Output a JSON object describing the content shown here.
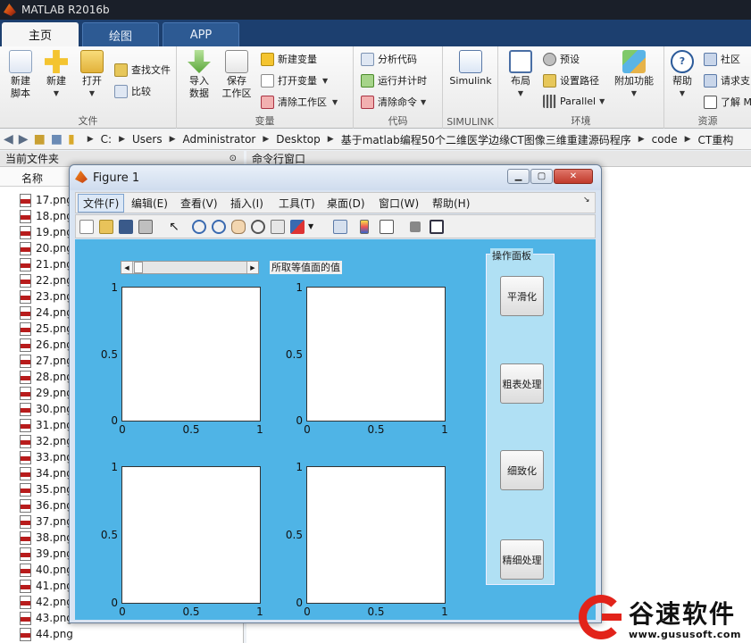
{
  "window": {
    "title": "MATLAB R2016b"
  },
  "ribbon_tabs": [
    {
      "label": "主页"
    },
    {
      "label": "绘图"
    },
    {
      "label": "APP"
    }
  ],
  "ribbon": {
    "file": {
      "group_label": "文件",
      "new_script": "新建\n脚本",
      "new": "新建",
      "open": "打开",
      "find_files": "查找文件",
      "compare": "比较"
    },
    "variable": {
      "group_label": "变量",
      "import_data": "导入\n数据",
      "save_workspace": "保存\n工作区",
      "new_variable": "新建变量",
      "open_variable": "打开变量",
      "clear_workspace": "清除工作区"
    },
    "code": {
      "group_label": "代码",
      "analyze_code": "分析代码",
      "run_and_time": "运行并计时",
      "clear_commands": "清除命令"
    },
    "simulink": {
      "group_label": "SIMULINK",
      "simulink": "Simulink"
    },
    "environment": {
      "group_label": "环境",
      "layout": "布局",
      "preferences": "预设",
      "set_path": "设置路径",
      "parallel": "Parallel",
      "addons": "附加功能"
    },
    "resources": {
      "group_label": "资源",
      "help": "帮助",
      "community": "社区",
      "request_support": "请求支",
      "learn": "了解 M"
    }
  },
  "address": {
    "path": [
      "C:",
      "Users",
      "Administrator",
      "Desktop",
      "基于matlab编程50个二维医学边缘CT图像三维重建源码程序",
      "code",
      "CT重构"
    ]
  },
  "current_folder": {
    "header": "当前文件夹",
    "column_name": "名称",
    "files": [
      "17.png",
      "18.png",
      "19.png",
      "20.png",
      "21.png",
      "22.png",
      "23.png",
      "24.png",
      "25.png",
      "26.png",
      "27.png",
      "28.png",
      "29.png",
      "30.png",
      "31.png",
      "32.png",
      "33.png",
      "34.png",
      "35.png",
      "36.png",
      "37.png",
      "38.png",
      "39.png",
      "40.png",
      "41.png",
      "42.png",
      "43.png",
      "44.png"
    ]
  },
  "command_window": {
    "header": "命令行窗口"
  },
  "figure": {
    "title": "Figure 1",
    "menus": [
      "文件(F)",
      "编辑(E)",
      "查看(V)",
      "插入(I)",
      "工具(T)",
      "桌面(D)",
      "窗口(W)",
      "帮助(H)"
    ],
    "toolbar_icons": [
      "new-figure-icon",
      "open-file-icon",
      "save-icon",
      "print-icon",
      "pointer-icon",
      "zoom-in-icon",
      "zoom-out-icon",
      "pan-icon",
      "rotate-icon",
      "data-cursor-icon",
      "brush-icon",
      "link-icon",
      "colorbar-icon",
      "legend-icon",
      "hide-tools-icon",
      "dock-icon"
    ],
    "slider_label": "所取等值面的值",
    "axes_ticks": {
      "x": [
        "0",
        "0.5",
        "1"
      ],
      "y": [
        "0",
        "0.5",
        "1"
      ]
    },
    "control_panel": {
      "title": "操作面板",
      "buttons": [
        "平滑化",
        "粗表处理",
        "细致化",
        "精细处理"
      ]
    }
  },
  "watermark": {
    "name": "谷速软件",
    "url": "www.gususoft.com"
  },
  "colors": {
    "figure_bg": "#4fb4e6",
    "panel_bg": "#b0e0f4",
    "ribbon_tab_bar": "#1c3f6f",
    "watermark_red": "#e2231a"
  }
}
